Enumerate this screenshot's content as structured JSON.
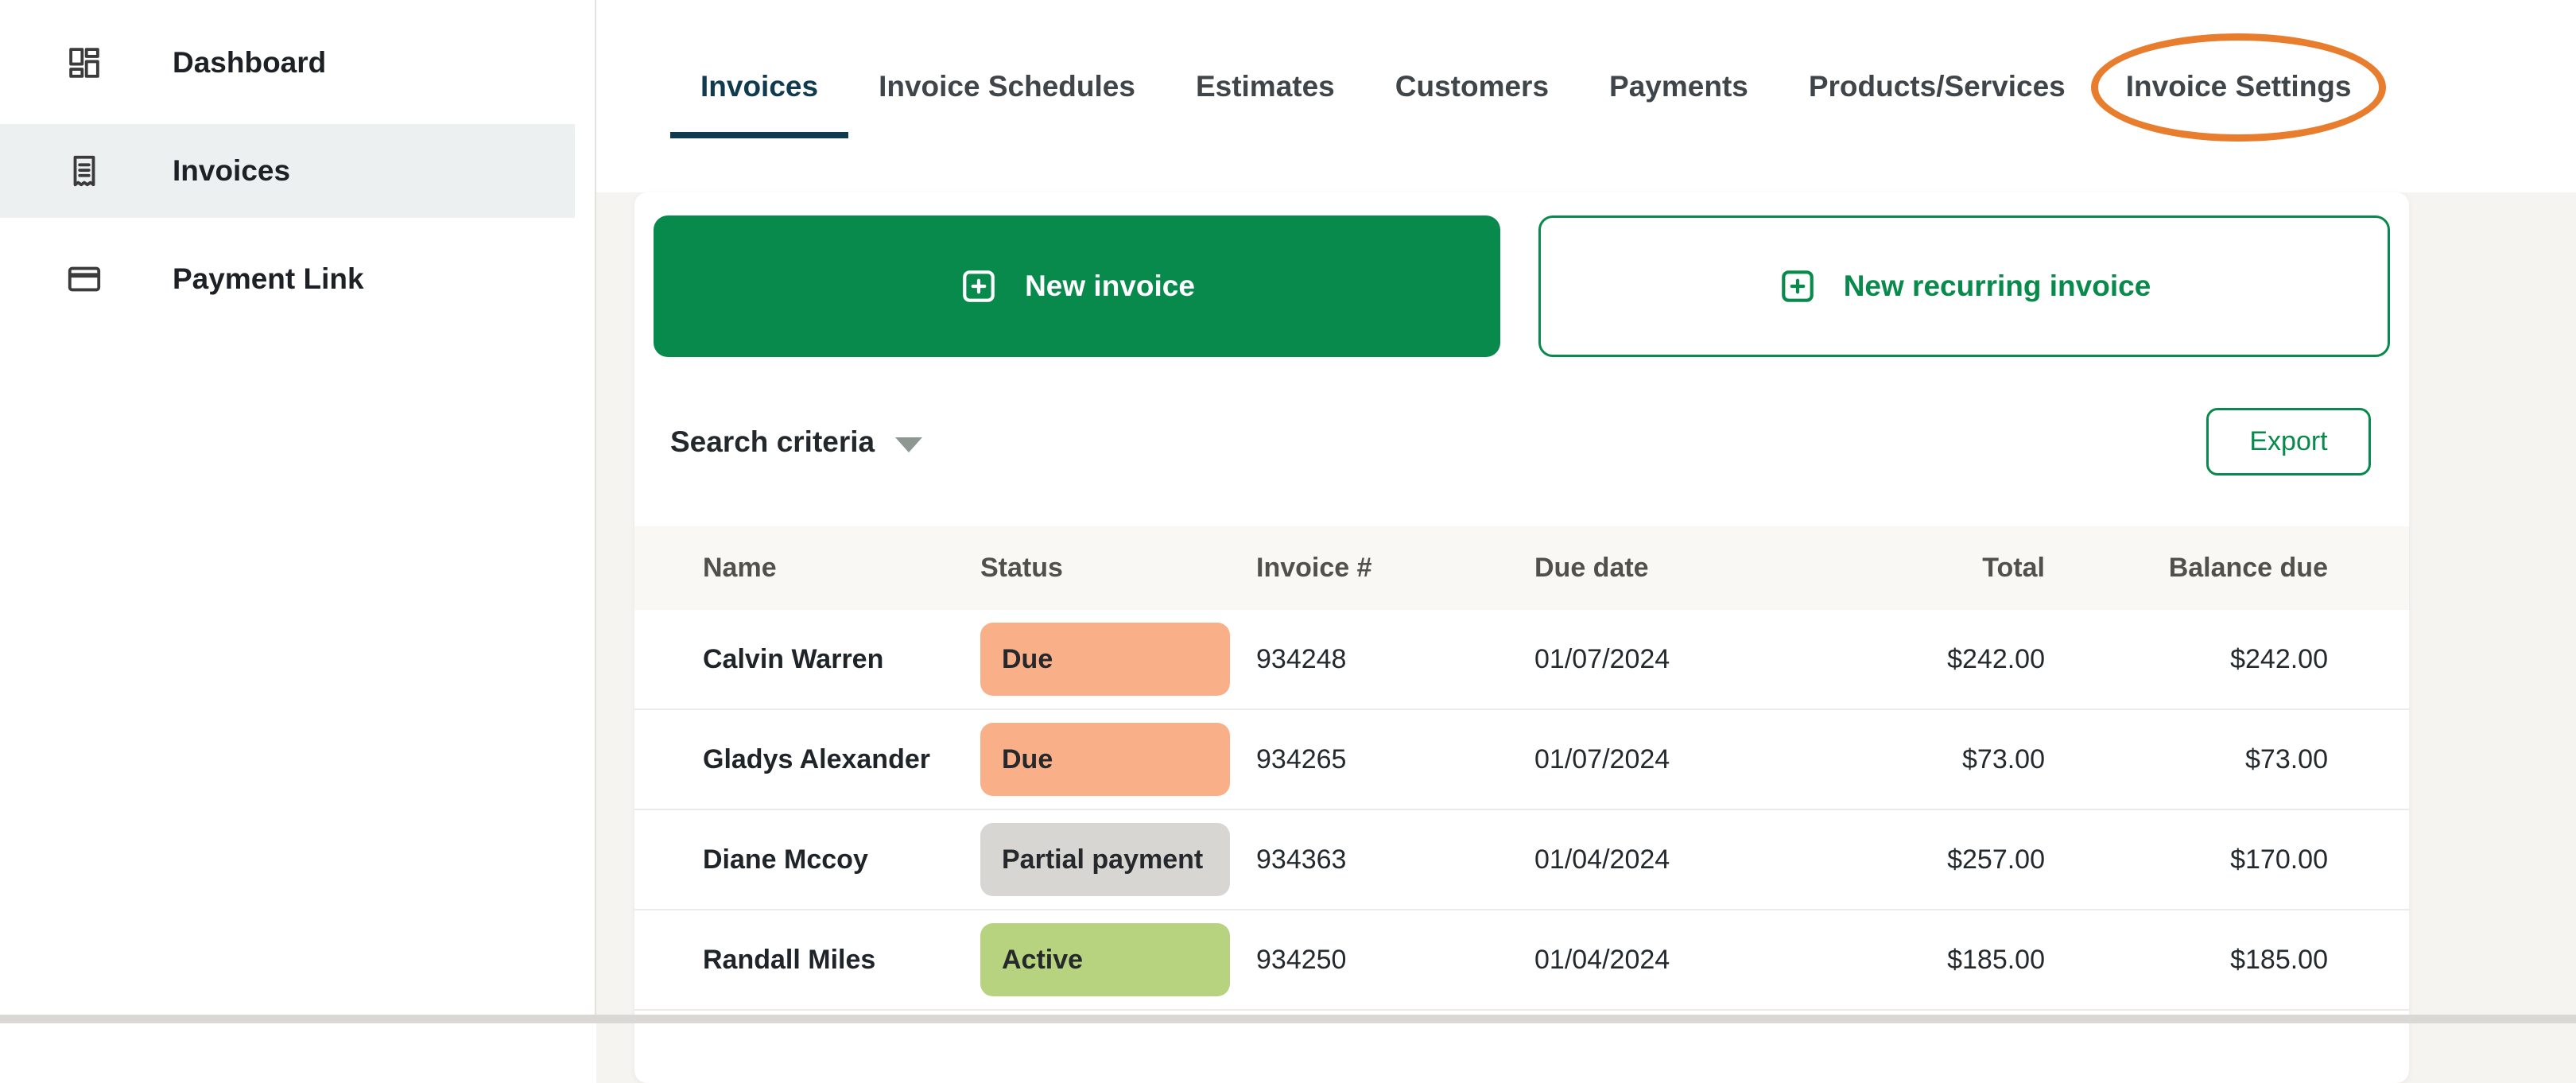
{
  "sidebar": {
    "items": [
      {
        "label": "Dashboard",
        "icon": "dashboard-grid-icon",
        "active": false
      },
      {
        "label": "Invoices",
        "icon": "receipt-icon",
        "active": true
      },
      {
        "label": "Payment Link",
        "icon": "card-icon",
        "active": false
      }
    ]
  },
  "tabs": [
    {
      "label": "Invoices",
      "active": true
    },
    {
      "label": "Invoice Schedules",
      "active": false
    },
    {
      "label": "Estimates",
      "active": false
    },
    {
      "label": "Customers",
      "active": false
    },
    {
      "label": "Payments",
      "active": false
    },
    {
      "label": "Products/Services",
      "active": false
    },
    {
      "label": "Invoice Settings",
      "active": false,
      "annotated": true
    }
  ],
  "actions": {
    "new_invoice": "New invoice",
    "new_recurring_invoice": "New recurring invoice",
    "search_criteria": "Search criteria",
    "export": "Export"
  },
  "table": {
    "columns": [
      "Name",
      "Status",
      "Invoice #",
      "Due date",
      "Total",
      "Balance due"
    ],
    "rows": [
      {
        "name": "Calvin Warren",
        "status": "Due",
        "status_color": "#F9B088",
        "invoice": "934248",
        "due_date": "01/07/2024",
        "total": "$242.00",
        "balance_due": "$242.00"
      },
      {
        "name": "Gladys Alexander",
        "status": "Due",
        "status_color": "#F9B088",
        "invoice": "934265",
        "due_date": "01/07/2024",
        "total": "$73.00",
        "balance_due": "$73.00"
      },
      {
        "name": "Diane Mccoy",
        "status": "Partial payment",
        "status_color": "#D8D6D3",
        "invoice": "934363",
        "due_date": "01/04/2024",
        "total": "$257.00",
        "balance_due": "$170.00"
      },
      {
        "name": "Randall Miles",
        "status": "Active",
        "status_color": "#B7D37F",
        "invoice": "934250",
        "due_date": "01/04/2024",
        "total": "$185.00",
        "balance_due": "$185.00"
      }
    ]
  },
  "colors": {
    "green": "#088A4C",
    "active_tab": "#0F3A4F",
    "annotation_orange": "#E87D2E",
    "badge_due": "#F9B088",
    "badge_partial": "#D8D6D3",
    "badge_active": "#B7D37F"
  }
}
